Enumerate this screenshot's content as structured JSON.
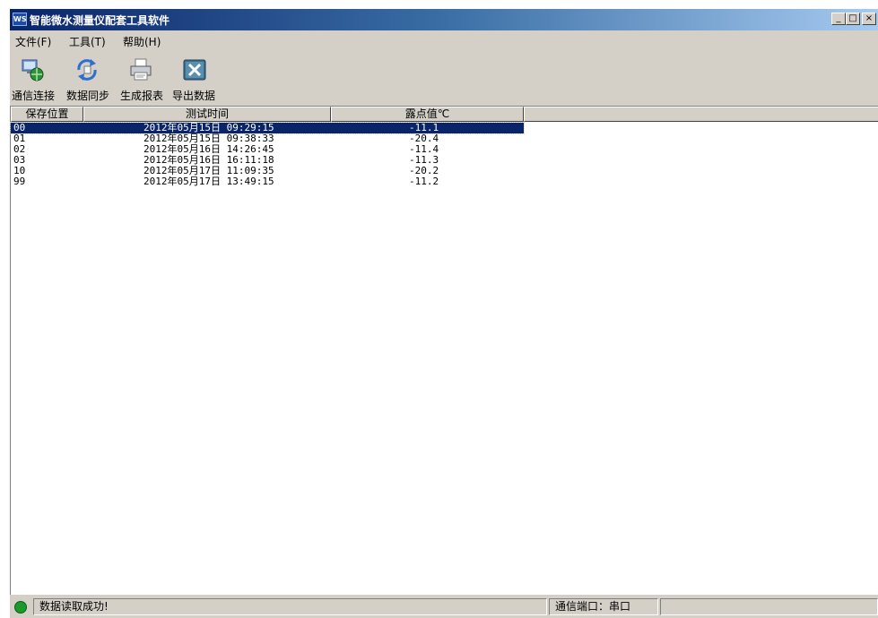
{
  "window": {
    "app_icon": "WS",
    "title": "智能微水测量仪配套工具软件",
    "controls": {
      "minimize": "_",
      "maximize": "□",
      "close": "×"
    }
  },
  "menu": [
    "文件(F)",
    "工具(T)",
    "帮助(H)"
  ],
  "toolbar": [
    {
      "label": "通信连接",
      "icon": "network-connect-icon"
    },
    {
      "label": "数据同步",
      "icon": "sync-icon"
    },
    {
      "label": "生成报表",
      "icon": "printer-icon"
    },
    {
      "label": "导出数据",
      "icon": "excel-export-icon"
    }
  ],
  "table": {
    "headers": [
      "保存位置",
      "测试时间",
      "露点值℃",
      ""
    ],
    "rows": [
      {
        "pos": "00",
        "time": "2012年05月15日 09:29:15",
        "dew": "-11.1",
        "selected": true
      },
      {
        "pos": "01",
        "time": "2012年05月15日 09:38:33",
        "dew": "-20.4"
      },
      {
        "pos": "02",
        "time": "2012年05月16日 14:26:45",
        "dew": "-11.4"
      },
      {
        "pos": "03",
        "time": "2012年05月16日 16:11:18",
        "dew": "-11.3"
      },
      {
        "pos": "10",
        "time": "2012年05月17日 11:09:35",
        "dew": "-20.2"
      },
      {
        "pos": "99",
        "time": "2012年05月17日 13:49:15",
        "dew": "-11.2"
      }
    ]
  },
  "status": {
    "indicator_color": "#1a9a2a",
    "message": "数据读取成功!",
    "port": "通信端口：串口",
    "extra": ""
  }
}
